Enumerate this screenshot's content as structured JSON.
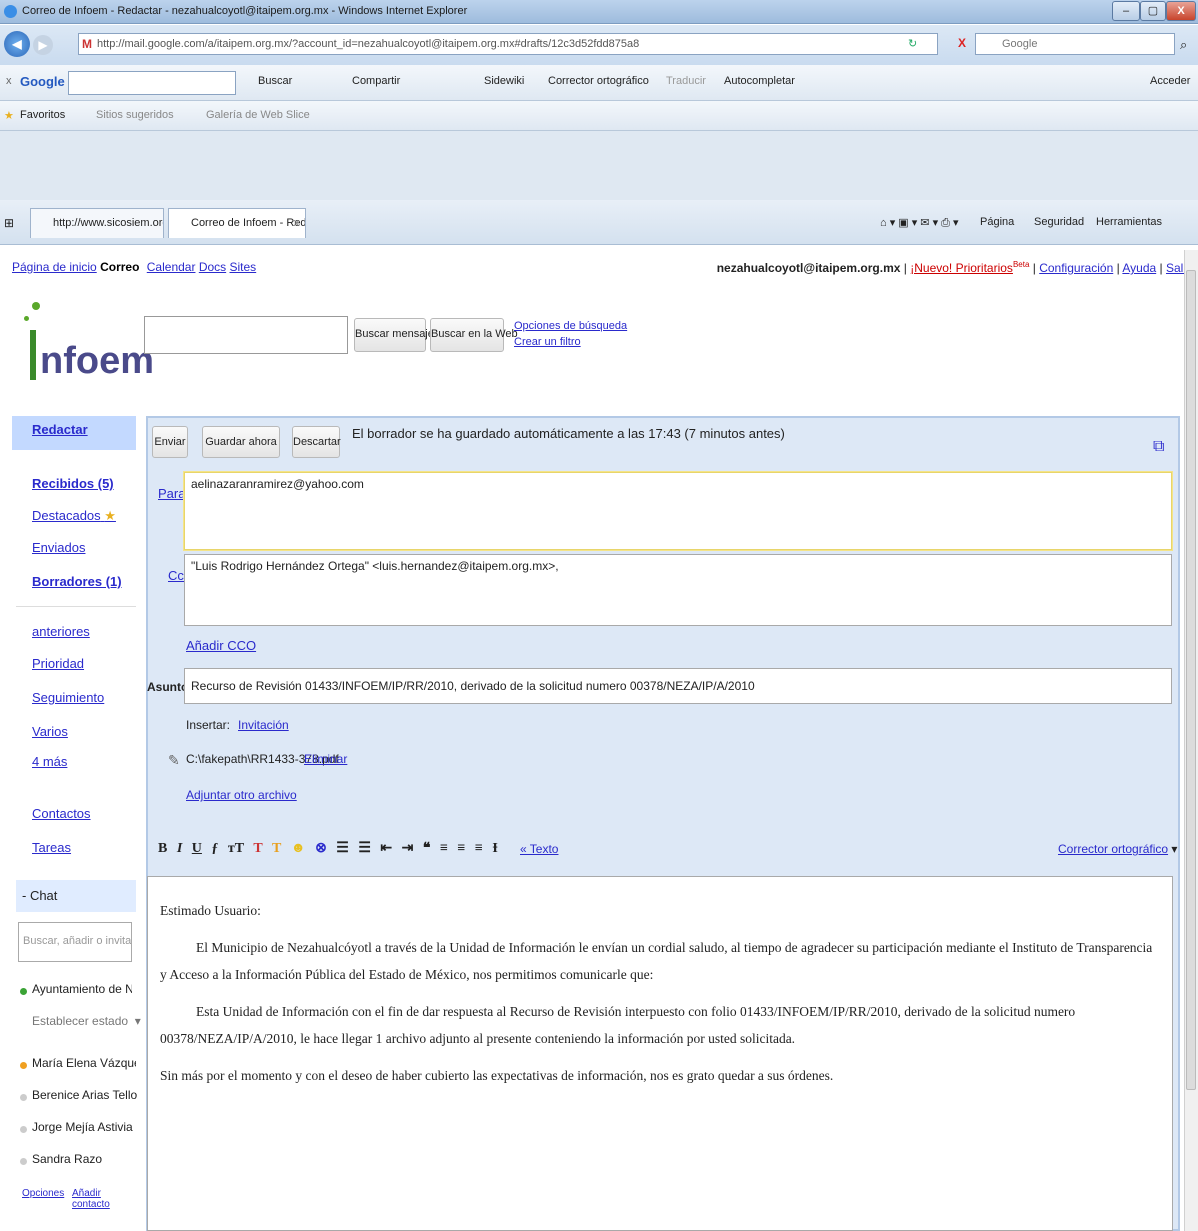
{
  "window": {
    "title": "Correo de Infoem - Redactar - nezahualcoyotl@itaipem.org.mx - Windows Internet Explorer",
    "url": "http://mail.google.com/a/itaipem.org.mx/?account_id=nezahualcoyotl@itaipem.org.mx#drafts/12c3d52fdd875a8",
    "search_placeholder": "Google",
    "minimize": "–",
    "maximize": "▢",
    "close": "X"
  },
  "google_toolbar": {
    "label": "Google",
    "buscar": "Buscar",
    "compartir": "Compartir",
    "sidewiki": "Sidewiki",
    "corrector": "Corrector ortográfico",
    "traducir": "Traducir",
    "autocompletar": "Autocompletar",
    "acceder": "Acceder"
  },
  "favorites_bar": {
    "favoritos": "Favoritos",
    "sitios": "Sitios sugeridos",
    "galeria": "Galería de Web Slice"
  },
  "browser_tabs": [
    {
      "label": "http://www.sicosiem.org..."
    },
    {
      "label": "Correo de Infoem - Red..."
    }
  ],
  "command_bar": {
    "pagina": "Página",
    "seguridad": "Seguridad",
    "herramientas": "Herramientas"
  },
  "gmail_nav": {
    "items": [
      "Página de inicio",
      "Correo",
      "Calendar",
      "Docs",
      "Sites"
    ],
    "user": "nezahualcoyotl@itaipem.org.mx",
    "prioritarios": "¡Nuevo! Prioritarios",
    "beta": "Beta",
    "configuracion": "Configuración",
    "ayuda": "Ayuda",
    "salir": "Salir"
  },
  "logo": {
    "text": "nfoem"
  },
  "search": {
    "buscar_mensaje": "Buscar mensaje",
    "buscar_web": "Buscar en la Web",
    "opciones": "Opciones de búsqueda",
    "crear_filtro": "Crear un filtro"
  },
  "sidebar": {
    "redactar": "Redactar",
    "recibidos": "Recibidos (5)",
    "destacados": "Destacados",
    "enviados": "Enviados",
    "borradores": "Borradores (1)",
    "labels": [
      "anteriores",
      "Prioridad",
      "Seguimiento",
      "Varios"
    ],
    "mas": "4 más",
    "contactos": "Contactos",
    "tareas": "Tareas",
    "chat_title": "- Chat",
    "chat_search_placeholder": "Buscar, añadir o invitar",
    "chat_me": "Ayuntamiento de Ne",
    "chat_status": "Establecer estado",
    "contacts": [
      "María Elena Vázquez",
      "Berenice Arias Tello",
      "Jorge Mejía Astivia",
      "Sandra Razo"
    ],
    "opciones": "Opciones",
    "anadir_contacto": "Añadir contacto"
  },
  "compose": {
    "enviar": "Enviar",
    "guardar": "Guardar ahora",
    "descartar": "Descartar",
    "saved_msg": "El borrador se ha guardado automáticamente a las 17:43 (7 minutos antes)",
    "para_label": "Para:",
    "para_value": "aelinazaranramirez@yahoo.com",
    "cc_label": "Cc:",
    "cc_value": "\"Luis Rodrigo Hernández Ortega\" <luis.hernandez@itaipem.org.mx>,",
    "anadir_cco": "Añadir CCO",
    "asunto_label": "Asunto:",
    "asunto_value": "Recurso de Revisión 01433/INFOEM/IP/RR/2010, derivado de la solicitud numero 00378/NEZA/IP/A/2010",
    "insertar_label": "Insertar:",
    "invitacion": "Invitación",
    "attachment": "C:\\fakepath\\RR1433-378.pdf",
    "eliminar": "Eliminar",
    "adjuntar": "Adjuntar otro archivo",
    "texto_link": "« Texto",
    "corrector": "Corrector ortográfico"
  },
  "message": {
    "greeting": "Estimado Usuario:",
    "p1": "El Municipio de Nezahualcóyotl a través de la Unidad de Información le envían un cordial saludo, al tiempo de agradecer su participación mediante el Instituto de Transparencia y Acceso a la Información Pública del Estado de México, nos permitimos comunicarle que:",
    "p2": "Esta Unidad de Información con el fin de dar respuesta al Recurso de Revisión interpuesto con folio 01433/INFOEM/IP/RR/2010, derivado de la solicitud numero 00378/NEZA/IP/A/2010, le hace llegar 1 archivo adjunto al presente conteniendo la información por usted solicitada.",
    "p3": "Sin más por el momento y con el deseo de haber cubierto las expectativas de información, nos es grato quedar a sus órdenes."
  },
  "colors": {
    "accent": "#2a2acc",
    "compose_bg": "#dde8f6",
    "chat_online": "#3aa335",
    "chat_away": "#f0a020"
  }
}
